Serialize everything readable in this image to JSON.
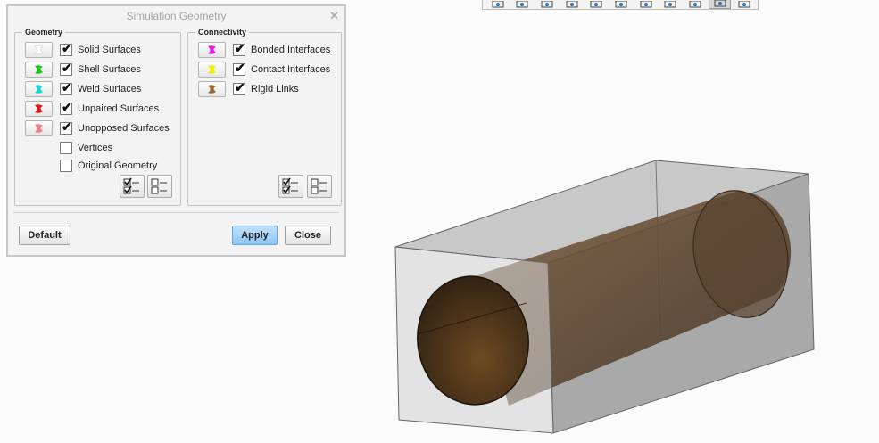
{
  "toolbar": {
    "icons": [
      "zoom-window-icon",
      "zoom-in-icon",
      "zoom-out-icon",
      "view-orient-icon",
      "saved-views-icon",
      "named-view-icon",
      "screenshot-icon",
      "spin-center-icon",
      "display-style-icon",
      "datum-display-icon",
      "simulation-display-icon"
    ],
    "active_index": 9
  },
  "dialog": {
    "title": "Simulation Geometry",
    "close_glyph": "✕",
    "geometry": {
      "legend": "Geometry",
      "items": [
        {
          "label": "Solid Surfaces",
          "checked": true,
          "swatch": "#ffffff"
        },
        {
          "label": "Shell Surfaces",
          "checked": true,
          "swatch": "#19c819"
        },
        {
          "label": "Weld Surfaces",
          "checked": true,
          "swatch": "#16d7d7"
        },
        {
          "label": "Unpaired Surfaces",
          "checked": true,
          "swatch": "#e01515"
        },
        {
          "label": "Unopposed Surfaces",
          "checked": true,
          "swatch": "#f08080"
        },
        {
          "label": "Vertices",
          "checked": false
        },
        {
          "label": "Original Geometry",
          "checked": false
        }
      ]
    },
    "connectivity": {
      "legend": "Connectivity",
      "items": [
        {
          "label": "Bonded Interfaces",
          "checked": true,
          "swatch": "#e020e0"
        },
        {
          "label": "Contact Interfaces",
          "checked": true,
          "swatch": "#f0f000"
        },
        {
          "label": "Rigid Links",
          "checked": true,
          "swatch": "#9a6a30"
        }
      ]
    },
    "buttons": {
      "default": "Default",
      "apply": "Apply",
      "close": "Close"
    }
  },
  "colors": {
    "accent": "#8ec6f3",
    "model_edge": "#555555",
    "cylinder": "#6b4a2a"
  }
}
